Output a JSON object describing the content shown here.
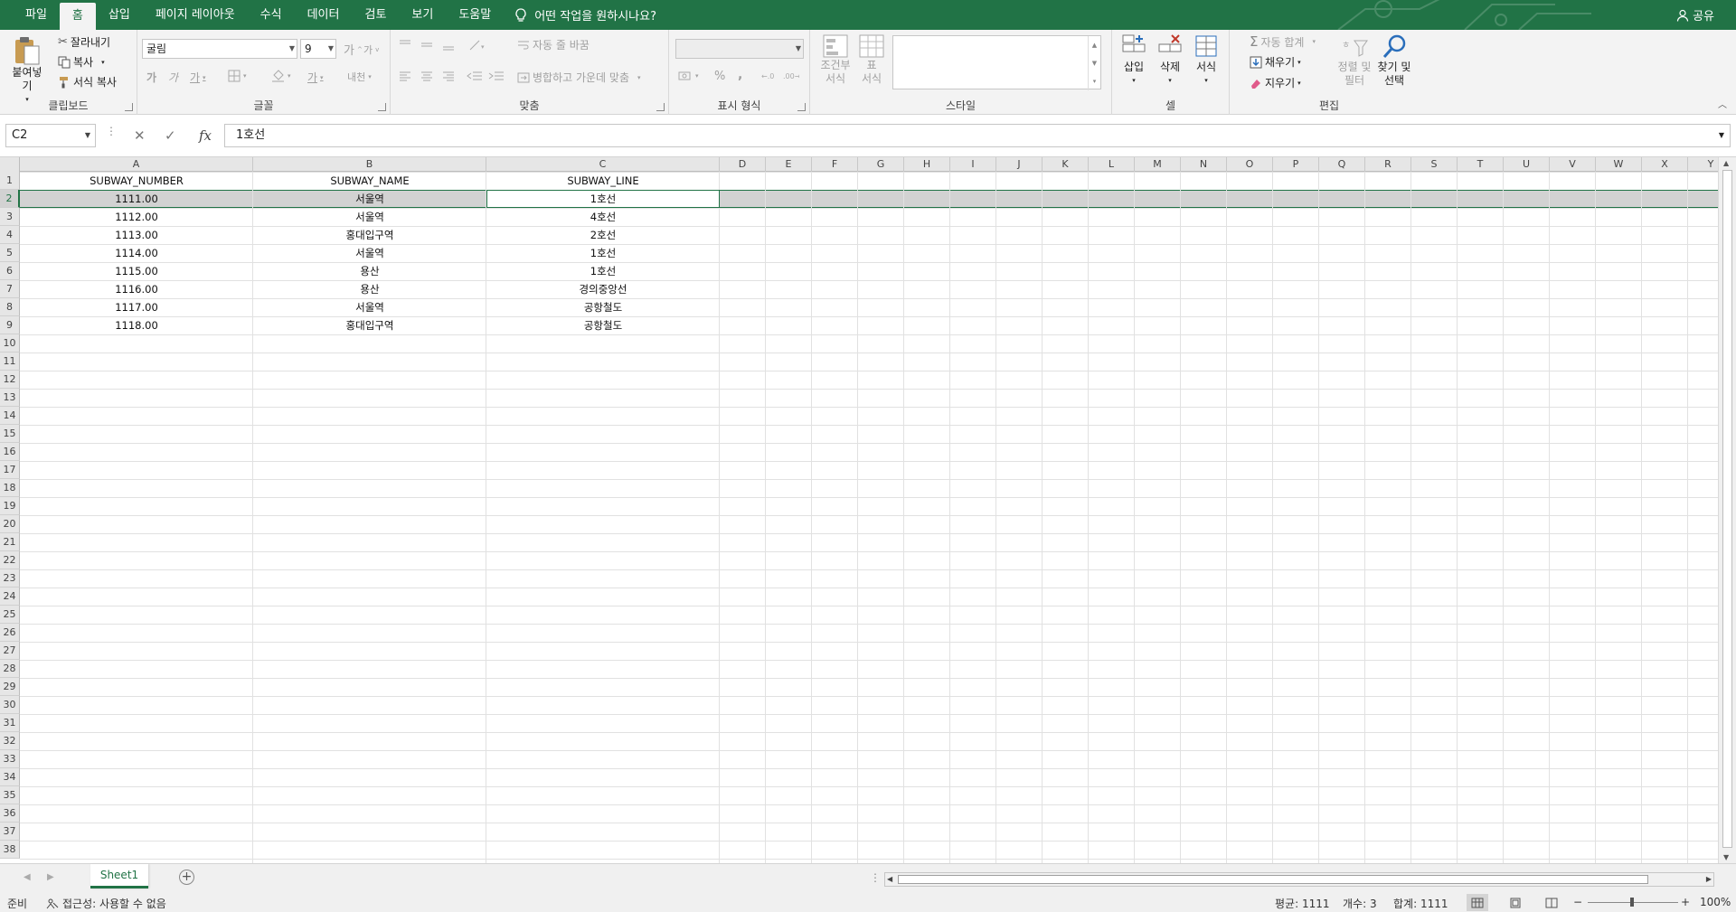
{
  "menu": {
    "tabs": [
      "파일",
      "홈",
      "삽입",
      "페이지 레이아웃",
      "수식",
      "데이터",
      "검토",
      "보기",
      "도움말"
    ],
    "active_index": 1,
    "tell_me": "어떤 작업을 원하시나요?",
    "share": "공유"
  },
  "ribbon": {
    "clipboard": {
      "paste": "붙여넣기",
      "cut": "잘라내기",
      "copy": "복사",
      "format_painter": "서식 복사",
      "group": "클립보드"
    },
    "font": {
      "font_name": "굴림",
      "font_size": "9",
      "group": "글꼴",
      "grow": "가",
      "shrink": "가",
      "bold": "가",
      "italic": "가",
      "underline": "가",
      "font_color": "가",
      "phonetic": "내천"
    },
    "alignment": {
      "wrap": "자동 줄 바꿈",
      "merge": "병합하고 가운데 맞춤",
      "group": "맞춤"
    },
    "number": {
      "format": "",
      "percent": "%",
      "comma": ",",
      "group": "표시 형식"
    },
    "styles": {
      "conditional": "조건부\n서식",
      "table": "표\n서식",
      "group": "스타일"
    },
    "cells": {
      "insert": "삽입",
      "delete": "삭제",
      "format": "서식",
      "group": "셀"
    },
    "editing": {
      "autosum": "자동 합계",
      "fill": "채우기",
      "clear": "지우기",
      "sort": "정렬 및\n필터",
      "find": "찾기 및\n선택",
      "group": "편집"
    }
  },
  "formula_bar": {
    "name_box": "C2",
    "fx": "fx",
    "content": "1호선"
  },
  "sheet": {
    "columns": [
      "A",
      "B",
      "C",
      "D",
      "E",
      "F",
      "G",
      "H",
      "I",
      "J",
      "K",
      "L",
      "M",
      "N",
      "O",
      "P",
      "Q",
      "R",
      "S",
      "T",
      "U",
      "V",
      "W",
      "X",
      "Y"
    ],
    "row_numbers": [
      "1",
      "2",
      "3",
      "4",
      "5",
      "6",
      "7",
      "8",
      "9",
      "10",
      "11",
      "12",
      "13",
      "14",
      "15",
      "16",
      "17",
      "18",
      "19",
      "20",
      "21",
      "22",
      "23",
      "24",
      "25",
      "26",
      "27",
      "28",
      "29",
      "30",
      "31",
      "32",
      "33",
      "34",
      "35",
      "36",
      "37",
      "38"
    ],
    "selected_row": "2",
    "active_cell": "C2",
    "rows": [
      [
        "SUBWAY_NUMBER",
        "SUBWAY_NAME",
        "SUBWAY_LINE"
      ],
      [
        "1111.00",
        "서울역",
        "1호선"
      ],
      [
        "1112.00",
        "서울역",
        "4호선"
      ],
      [
        "1113.00",
        "홍대입구역",
        "2호선"
      ],
      [
        "1114.00",
        "서울역",
        "1호선"
      ],
      [
        "1115.00",
        "용산",
        "1호선"
      ],
      [
        "1116.00",
        "용산",
        "경의중앙선"
      ],
      [
        "1117.00",
        "서울역",
        "공항철도"
      ],
      [
        "1118.00",
        "홍대입구역",
        "공항철도"
      ]
    ]
  },
  "tabs": {
    "sheets": [
      "Sheet1"
    ],
    "active": "Sheet1"
  },
  "status": {
    "ready": "준비",
    "accessibility": "접근성: 사용할 수 없음",
    "average": "평균: 1111",
    "count": "개수: 3",
    "sum": "합계: 1111",
    "zoom": "100%",
    "zoom_minus": "−",
    "zoom_plus": "+"
  },
  "colors": {
    "accent": "#217346",
    "ribbon_bg": "#f3f3f3",
    "selection": "#d2d2d2"
  }
}
